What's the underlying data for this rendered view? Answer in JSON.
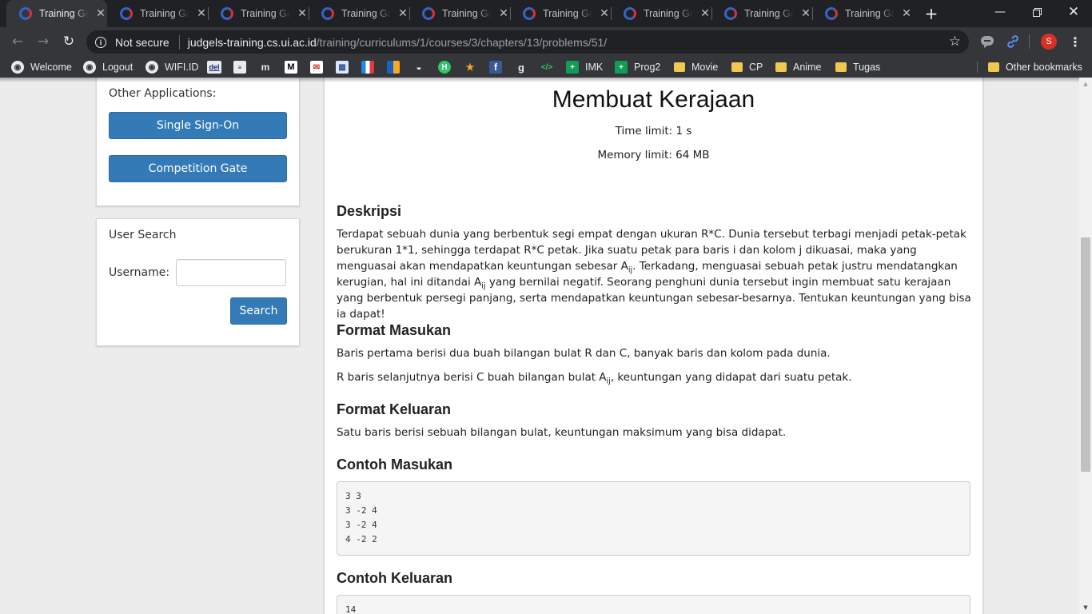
{
  "browser": {
    "tabs": [
      {
        "title": "Training Gate",
        "active": true
      },
      {
        "title": "Training Gate",
        "active": false
      },
      {
        "title": "Training Gate",
        "active": false
      },
      {
        "title": "Training Gate",
        "active": false
      },
      {
        "title": "Training Gate",
        "active": false
      },
      {
        "title": "Training Gate",
        "active": false
      },
      {
        "title": "Training Gate",
        "active": false
      },
      {
        "title": "Training Gate",
        "active": false
      },
      {
        "title": "Training Gate",
        "active": false
      }
    ],
    "security_label": "Not secure",
    "url_host": "judgels-training.cs.ui.ac.id",
    "url_path": "/training/curriculums/1/courses/3/chapters/13/problems/51/",
    "profile_initial": "S",
    "bookmarks": {
      "welcome": "Welcome",
      "logout": "Logout",
      "wifi": "WIFI.ID",
      "del": "del",
      "imk": "IMK",
      "prog2": "Prog2",
      "movie": "Movie",
      "cp": "CP",
      "anime": "Anime",
      "tugas": "Tugas",
      "other": "Other bookmarks"
    },
    "accent_colors": {
      "tab_favicon": "#3464c8",
      "profile": "#d93025",
      "folder": "#f0c84f"
    }
  },
  "sidebar": {
    "other_apps_label": "Other Applications:",
    "sso_button": "Single Sign-On",
    "competition_button": "Competition Gate",
    "user_search_title": "User Search",
    "username_label": "Username:",
    "username_value": "",
    "search_button": "Search"
  },
  "problem": {
    "title": "Membuat Kerajaan",
    "time_limit": "Time limit: 1 s",
    "memory_limit": "Memory limit: 64 MB",
    "desc_heading": "Deskripsi",
    "desc_part1": "Terdapat sebuah dunia yang berbentuk segi empat dengan ukuran R*C. Dunia tersebut terbagi menjadi petak-petak berukuran 1*1, sehingga terdapat R*C petak. Jika suatu petak para baris i dan kolom j dikuasai, maka yang menguasai akan mendapatkan keuntungan sebesar A",
    "desc_sub1": "ij",
    "desc_part2": ". Terkadang, menguasai sebuah petak justru mendatangkan kerugian, hal ini ditandai A",
    "desc_sub2": "ij",
    "desc_part3": " yang bernilai negatif. Seorang penghuni dunia tersebut ingin membuat satu kerajaan yang berbentuk persegi panjang, serta mendapatkan keuntungan sebesar-besarnya. Tentukan keuntungan yang bisa ia dapat!",
    "input_heading": "Format Masukan",
    "input_line1": "Baris pertama berisi dua buah bilangan bulat R dan C, banyak baris dan kolom pada dunia.",
    "input_line2_a": "R baris selanjutnya berisi C buah bilangan bulat A",
    "input_line2_sub": "ij",
    "input_line2_b": ", keuntungan yang didapat dari suatu petak.",
    "output_heading": "Format Keluaran",
    "output_line": "Satu baris berisi sebuah bilangan bulat, keuntungan maksimum yang bisa didapat.",
    "sample_input_heading": "Contoh Masukan",
    "sample_input": "3 3\n3 -2 4\n3 -2 4\n4 -2 2",
    "sample_output_heading": "Contoh Keluaran",
    "sample_output": "14"
  }
}
